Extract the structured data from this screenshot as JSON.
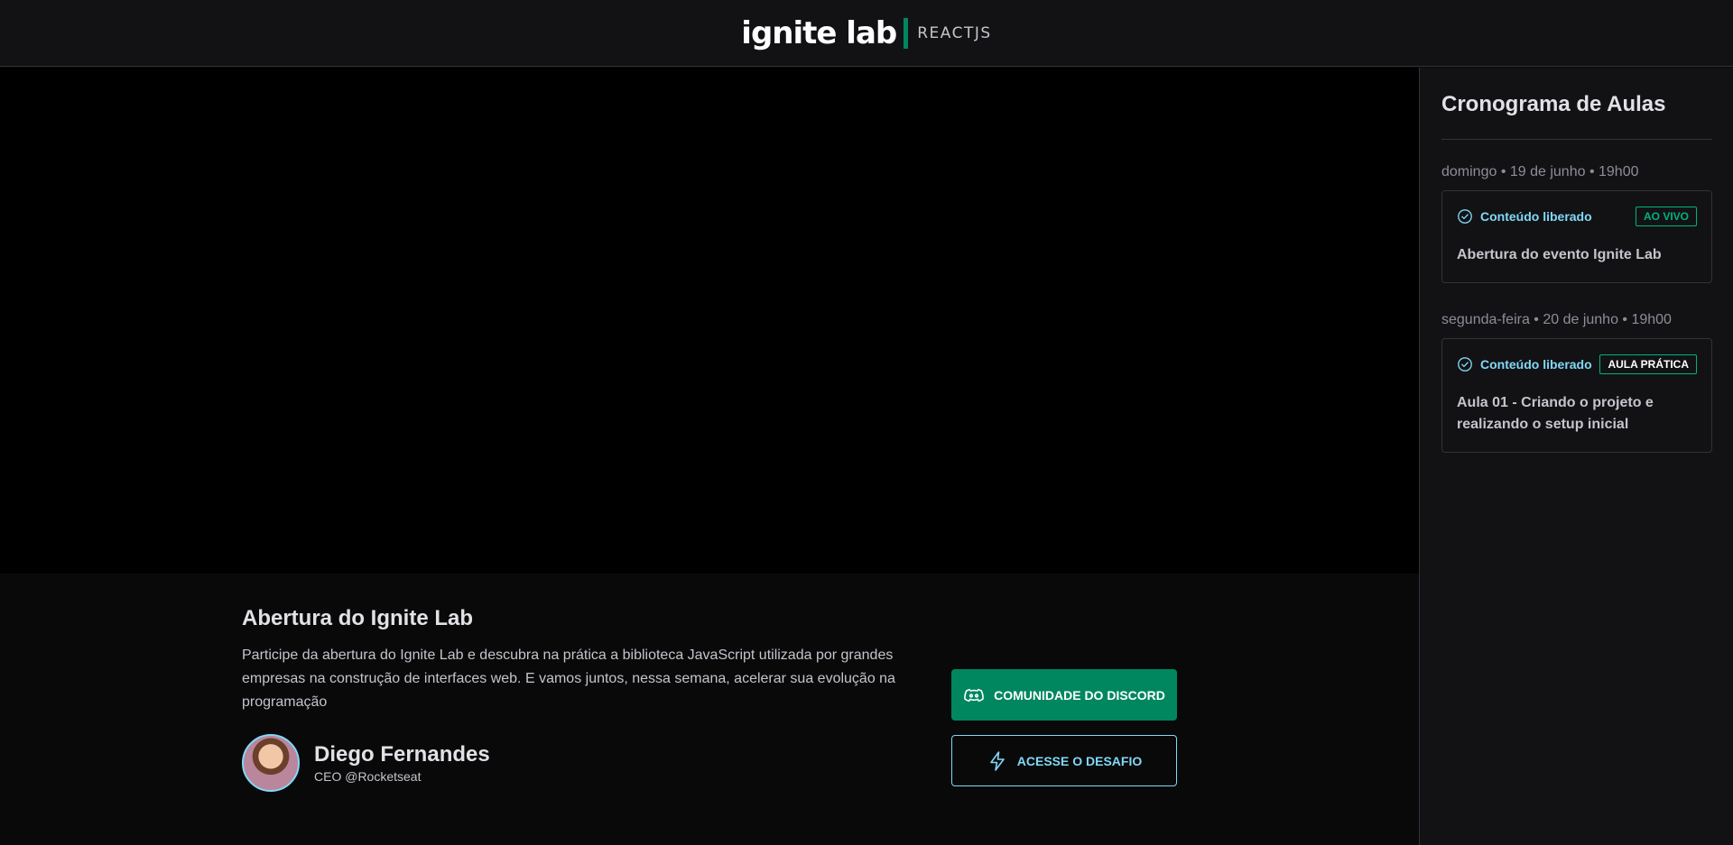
{
  "header": {
    "logo_main": "ignite lab",
    "logo_sub": "REACTJS"
  },
  "lesson": {
    "title": "Abertura do Ignite Lab",
    "description": "Participe da abertura do Ignite Lab e descubra na prática a biblioteca JavaScript utilizada por grandes empresas na construção de interfaces web. E vamos juntos, nessa semana, acelerar sua evolução na programação",
    "teacher_name": "Diego Fernandes",
    "teacher_role": "CEO @Rocketseat",
    "discord_button": "COMUNIDADE DO DISCORD",
    "challenge_button": "ACESSE O DESAFIO"
  },
  "sidebar": {
    "title": "Cronograma de Aulas",
    "lessons": [
      {
        "date": "domingo • 19 de junho • 19h00",
        "status": "Conteúdo liberado",
        "badge": "AO VIVO",
        "title": "Abertura do evento Ignite Lab"
      },
      {
        "date": "segunda-feira • 20 de junho • 19h00",
        "status": "Conteúdo liberado",
        "badge": "AULA PRÁTICA",
        "title": "Aula 01 - Criando o projeto e realizando o setup inicial"
      }
    ]
  },
  "colors": {
    "accent_green": "#00875f",
    "accent_blue": "#81d8f7",
    "background": "#09090a",
    "panel": "#121214"
  }
}
